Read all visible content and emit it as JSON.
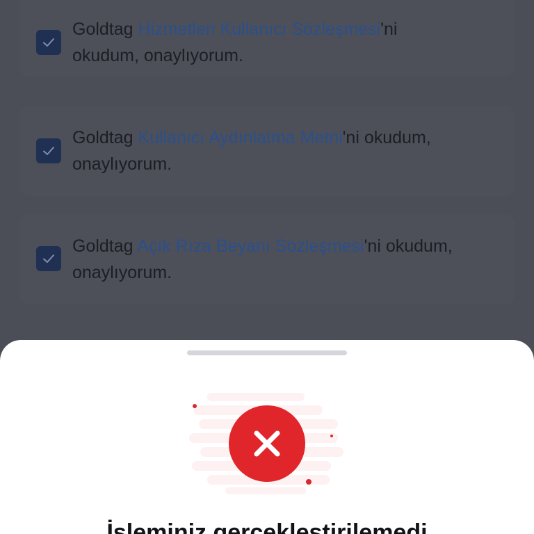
{
  "consents": [
    {
      "prefix": "Goldtag ",
      "link": "Hizmetleri Kullanıcı Sözleşmesi",
      "suffix_line1": "'ni",
      "line2": "okudum, onaylıyorum.",
      "checked": true
    },
    {
      "prefix": "Goldtag ",
      "link": "Kullanıcı Aydınlatma Metni",
      "suffix_line1": "'ni okudum,",
      "line2": "onaylıyorum.",
      "checked": true
    },
    {
      "prefix": "Goldtag ",
      "link": "Açık Rıza Beyanı Sözleşmesi",
      "suffix_line1": "'ni okudum,",
      "line2": "onaylıyorum.",
      "checked": true
    }
  ],
  "sheet": {
    "status": "error",
    "title": "İşleminiz gerçekleştirilemedi"
  },
  "colors": {
    "overlay": "#4b4e57",
    "link": "#2b4f8c",
    "checkbox": "#1f3052",
    "error": "#e0262b",
    "sheet_bg": "#ffffff"
  }
}
